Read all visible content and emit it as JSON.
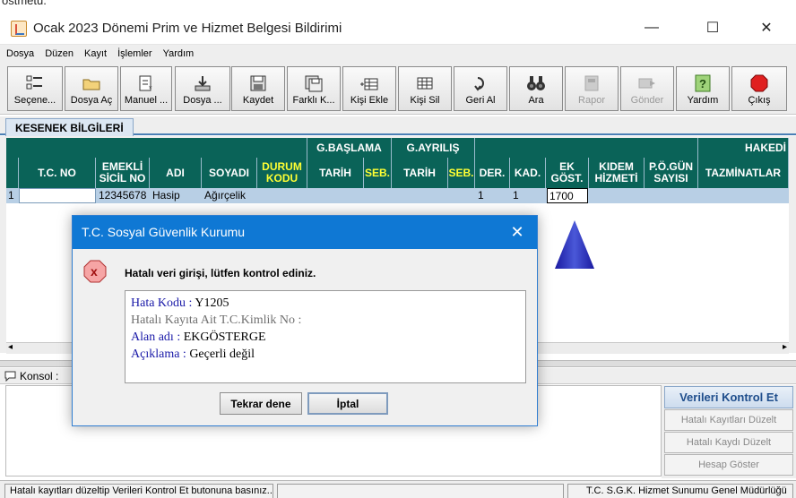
{
  "top_strip_text": "ostmetu.",
  "window": {
    "title": "Ocak 2023 Dönemi Prim ve Hizmet Belgesi Bildirimi",
    "min": "—",
    "max": "☐",
    "close": "✕"
  },
  "menu": [
    "Dosya",
    "Düzen",
    "Kayıt",
    "İşlemler",
    "Yardım"
  ],
  "toolbar": [
    {
      "label": "Seçene...",
      "icon": "options-icon",
      "enabled": true
    },
    {
      "label": "Dosya Aç",
      "icon": "folder-open-icon",
      "enabled": true
    },
    {
      "label": "Manuel ...",
      "icon": "manual-entry-icon",
      "enabled": true
    },
    {
      "label": "Dosya ...",
      "icon": "file-import-icon",
      "enabled": true
    },
    {
      "label": "Kaydet",
      "icon": "save-icon",
      "enabled": true
    },
    {
      "label": "Farklı K...",
      "icon": "save-as-icon",
      "enabled": true
    },
    {
      "label": "Kişi Ekle",
      "icon": "add-person-icon",
      "enabled": true
    },
    {
      "label": "Kişi Sil",
      "icon": "delete-person-icon",
      "enabled": true
    },
    {
      "label": "Geri Al",
      "icon": "undo-icon",
      "enabled": true
    },
    {
      "label": "Ara",
      "icon": "binoculars-icon",
      "enabled": true
    },
    {
      "label": "Rapor",
      "icon": "report-icon",
      "enabled": false
    },
    {
      "label": "Gönder",
      "icon": "send-icon",
      "enabled": false
    },
    {
      "label": "Yardım",
      "icon": "help-icon",
      "enabled": true
    },
    {
      "label": "Çıkış",
      "icon": "stop-icon",
      "enabled": true
    }
  ],
  "tab": "KESENEK BİLGİLERİ",
  "grid": {
    "group_headers": {
      "g_baslama": "G.BAŞLAMA",
      "g_ayrilis": "G.AYRILIŞ",
      "hakedis": "HAKEDİ"
    },
    "columns": {
      "tc": "T.C. NO",
      "emekli": "EMEKLİ SİCİL NO",
      "adi": "ADI",
      "soyadi": "SOYADI",
      "durum": "DURUM KODU",
      "tarih1": "TARİH",
      "seb1": "SEB.",
      "tarih2": "TARİH",
      "seb2": "SEB.",
      "der": "DER.",
      "kad": "KAD.",
      "ek": "EK GÖST.",
      "kidem": "KIDEM HİZMETİ",
      "pogun": "P.Ö.GÜN SAYISI",
      "tazminat": "TAZMİNATLAR"
    },
    "row": {
      "index": "1",
      "tc": "",
      "emekli": "12345678",
      "adi": "Hasip",
      "soyadi": "Ağırçelik",
      "der": "1",
      "kad": "1",
      "ek": "1700"
    }
  },
  "konsol_label": "Konsol :",
  "right_panel": {
    "check": "Verileri Kontrol Et",
    "fix_all": "Hatalı Kayıtları Düzelt",
    "fix_one": "Hatalı Kaydı Düzelt",
    "calc": "Hesap Göster"
  },
  "status": {
    "left": "Hatalı kayıtları düzeltip Verileri Kontrol Et butonuna basınız...",
    "right": "T.C. S.G.K. Hizmet Sunumu Genel Müdürlüğü"
  },
  "dialog": {
    "title": "T.C. Sosyal Güvenlik Kurumu",
    "close": "✕",
    "message": "Hatalı veri girişi, lütfen kontrol ediniz.",
    "error_code_label": "Hata Kodu : ",
    "error_code": "Y1205",
    "tc_label": "Hatalı Kayıta Ait T.C.Kimlik No :",
    "field_label": "Alan adı : ",
    "field_value": "EKGÖSTERGE",
    "desc_label": "Açıklama : ",
    "desc_value": "Geçerli değil",
    "retry": "Tekrar dene",
    "cancel": "İptal"
  },
  "colors": {
    "grid_header": "#0a6358",
    "highlight_header": "#ffff33",
    "dialog_title": "#0f78d4",
    "selected_row": "#b8cfe5"
  }
}
